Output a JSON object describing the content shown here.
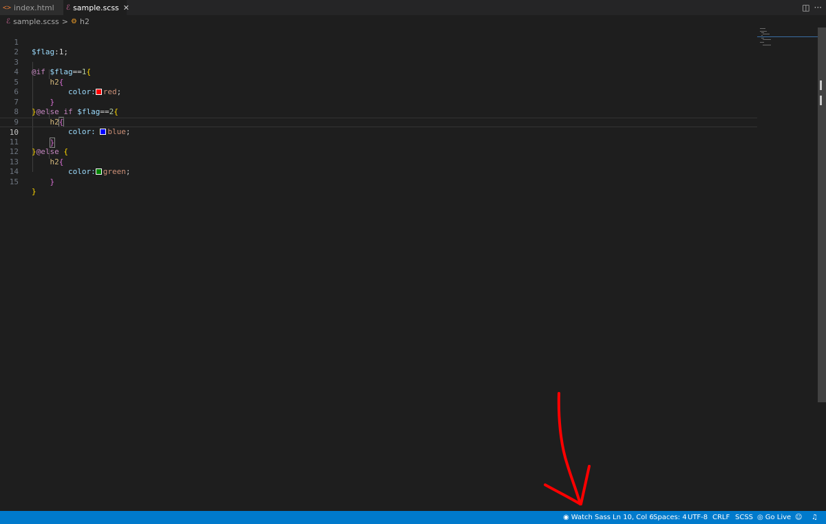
{
  "tabs": [
    {
      "label": "index.html",
      "icon": "html-brackets-icon",
      "active": false
    },
    {
      "label": "sample.scss",
      "icon": "sass-icon",
      "active": true,
      "close": "✕"
    }
  ],
  "tab_actions": {
    "split": "◫",
    "more": "···"
  },
  "breadcrumb": {
    "file": "sample.scss",
    "separator": ">",
    "symbol": "h2"
  },
  "editor": {
    "current_line": 10,
    "lines": [
      {
        "n": "1"
      },
      {
        "n": "2"
      },
      {
        "n": "3"
      },
      {
        "n": "4"
      },
      {
        "n": "5"
      },
      {
        "n": "6"
      },
      {
        "n": "7"
      },
      {
        "n": "8"
      },
      {
        "n": "9"
      },
      {
        "n": "10"
      },
      {
        "n": "11"
      },
      {
        "n": "12"
      },
      {
        "n": "13"
      },
      {
        "n": "14"
      },
      {
        "n": "15"
      }
    ],
    "code": {
      "l1_var": "$flag",
      "l1_rest": ":1;",
      "l3_kw": "@if",
      "l3_var": "$flag",
      "l3_op": "==",
      "l3_num": "1",
      "l3_brace": "{",
      "l4_sel": "h2",
      "l4_brace": "{",
      "l5_prop": "color:",
      "l5_val": "red",
      "l5_semi": ";",
      "l6_brace": "}",
      "l7_close": "}",
      "l7_kw": "@else if",
      "l7_var": "$flag",
      "l7_op": "==",
      "l7_num": "2",
      "l7_brace": "{",
      "l8_sel": "h2",
      "l8_brace": "{",
      "l9_prop": "color:",
      "l9_val": "blue",
      "l9_semi": ";",
      "l10_brace": "}",
      "l11_close": "}",
      "l11_kw": "@else",
      "l11_brace": "{",
      "l12_sel": "h2",
      "l12_brace": "{",
      "l13_prop": "color:",
      "l13_val": "green",
      "l13_semi": ";",
      "l14_brace": "}",
      "l15_brace": "}"
    },
    "swatch_colors": {
      "red": "#ff0000",
      "blue": "#0000ff",
      "green": "#008000"
    }
  },
  "statusbar": {
    "watch_sass": "Watch Sass",
    "position": "Ln 10, Col 6",
    "spaces": "Spaces: 4",
    "encoding": "UTF-8",
    "eol": "CRLF",
    "language": "SCSS",
    "go_live": "Go Live",
    "background": "#007acc"
  },
  "annotation": {
    "color": "#ff0000"
  }
}
